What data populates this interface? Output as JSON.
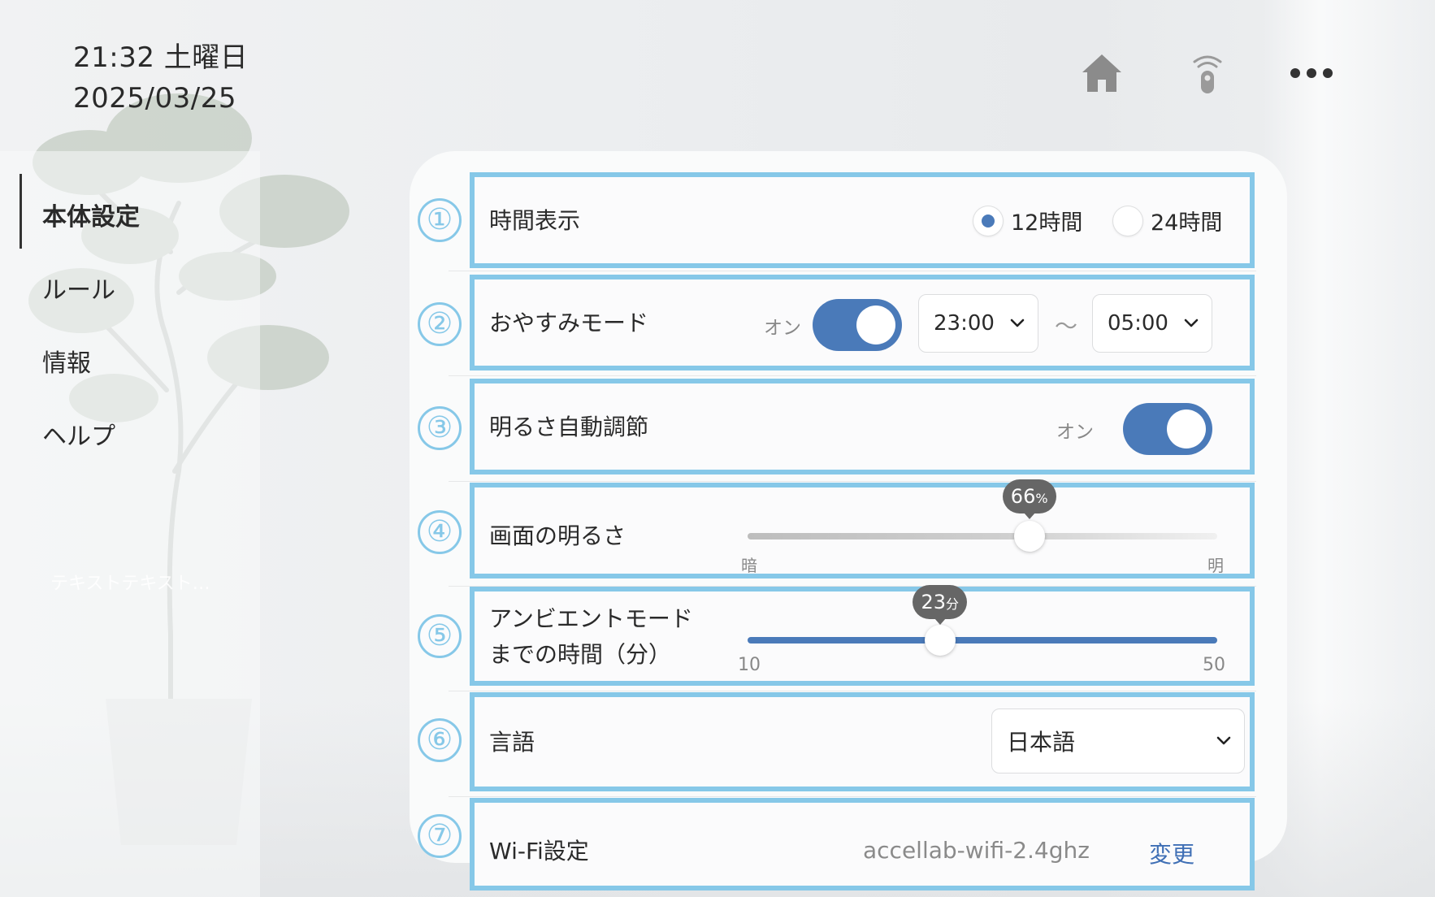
{
  "header": {
    "time_line": "21:32 土曜日",
    "date_line": "2025/03/25"
  },
  "icons": {
    "home": "home-icon",
    "remote": "remote-control-icon",
    "more": "more-dots-icon"
  },
  "sidebar": {
    "items": [
      {
        "label": "本体設定",
        "active": true
      },
      {
        "label": "ルール"
      },
      {
        "label": "情報"
      },
      {
        "label": "ヘルプ"
      }
    ],
    "ghost_text": "テキストテキスト…"
  },
  "settings": {
    "time_display": {
      "number": "①",
      "label": "時間表示",
      "options": [
        "12時間",
        "24時間"
      ],
      "selected": "12時間"
    },
    "sleep_mode": {
      "number": "②",
      "label": "おやすみモード",
      "state_text": "オン",
      "enabled": true,
      "start": "23:00",
      "separator": "～",
      "end": "05:00"
    },
    "auto_brightness": {
      "number": "③",
      "label": "明るさ自動調節",
      "state_text": "オン",
      "enabled": true
    },
    "screen_brightness": {
      "number": "④",
      "label": "画面の明るさ",
      "value": "66",
      "unit": "%",
      "fraction": 0.6,
      "min_label": "暗",
      "max_label": "明"
    },
    "ambient_mode": {
      "number": "⑤",
      "label_line1": "アンビエントモード",
      "label_line2": "までの時間（分）",
      "value": "23",
      "unit": "分",
      "min": "10",
      "max": "50",
      "fraction": 0.41
    },
    "language": {
      "number": "⑥",
      "label": "言語",
      "selected": "日本語"
    },
    "wifi": {
      "number": "⑦",
      "label": "Wi-Fi設定",
      "network": "accellab-wifi-2.4ghz",
      "change_label": "変更"
    }
  },
  "colors": {
    "accent": "#4a7ab9",
    "annotation": "#86c8e8"
  }
}
